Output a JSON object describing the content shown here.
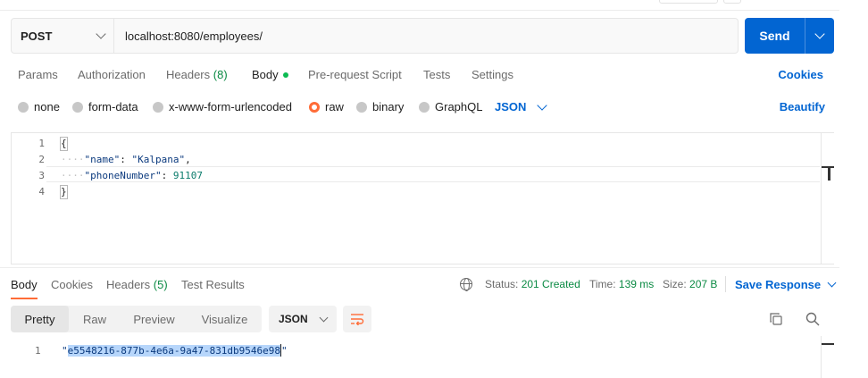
{
  "request": {
    "method": "POST",
    "url": "localhost:8080/employees/",
    "send_label": "Send"
  },
  "request_tabs": {
    "params": "Params",
    "authorization": "Authorization",
    "headers": "Headers",
    "headers_count": "(8)",
    "body": "Body",
    "pre_request_script": "Pre-request Script",
    "tests": "Tests",
    "settings": "Settings",
    "cookies": "Cookies"
  },
  "body_options": {
    "none": "none",
    "form_data": "form-data",
    "urlencoded": "x-www-form-urlencoded",
    "raw": "raw",
    "binary": "binary",
    "graphql": "GraphQL",
    "format": "JSON",
    "beautify": "Beautify",
    "selected": "raw"
  },
  "request_body": {
    "line_numbers": [
      "1",
      "2",
      "3",
      "4"
    ],
    "open_brace": "{",
    "close_brace": "}",
    "indent": "····",
    "key1": "\"name\"",
    "sep1": ": ",
    "value1": "\"Kalpana\"",
    "comma": ",",
    "key2": "\"phoneNumber\"",
    "sep2": ": ",
    "value2": "91107"
  },
  "response_tabs": {
    "body": "Body",
    "cookies": "Cookies",
    "headers": "Headers",
    "headers_count": "(5)",
    "test_results": "Test Results"
  },
  "response_status": {
    "status_label": "Status:",
    "status_value": "201 Created",
    "time_label": "Time:",
    "time_value": "139 ms",
    "size_label": "Size:",
    "size_value": "207 B",
    "save_response": "Save Response"
  },
  "response_view": {
    "pretty": "Pretty",
    "raw": "Raw",
    "preview": "Preview",
    "visualize": "Visualize",
    "format": "JSON"
  },
  "response_body": {
    "line_number": "1",
    "quote_open": "\"",
    "value": "e5548216-877b-4e6a-9a47-831db9546e98",
    "quote_close": "\""
  },
  "colors": {
    "accent_blue": "#0265d2",
    "accent_orange": "#ff6c37",
    "status_green": "#0a8a43",
    "selection": "#b7d6fb"
  }
}
